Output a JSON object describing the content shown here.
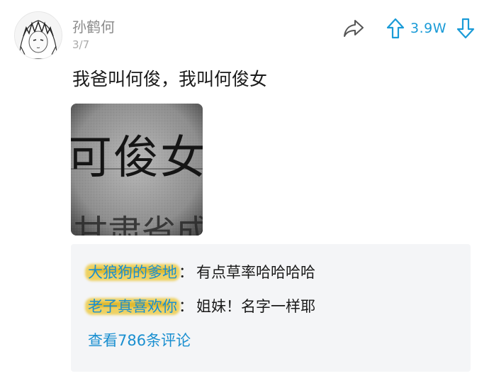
{
  "post": {
    "username": "孙鹤何",
    "date": "3/7",
    "text": "我爸叫何俊，我叫何俊女",
    "image_text": "可俊女",
    "image_text_partial": "甘肃省成",
    "vote_count": "3.9W"
  },
  "comments": [
    {
      "author": "大狼狗的爹地",
      "separator": "：",
      "text": "有点草率哈哈哈哈"
    },
    {
      "author": "老子真喜欢你",
      "separator": "：",
      "text": "姐妹！名字一样耶"
    }
  ],
  "view_all_label": "查看786条评论",
  "colors": {
    "accent": "#1a9bd7",
    "link": "#1a8fd0",
    "comment_bg": "#f4f5f7",
    "smudge": "#ecc428"
  },
  "icons": {
    "share": "share-arrow-icon",
    "upvote": "arrow-up-icon",
    "downvote": "arrow-down-icon"
  }
}
